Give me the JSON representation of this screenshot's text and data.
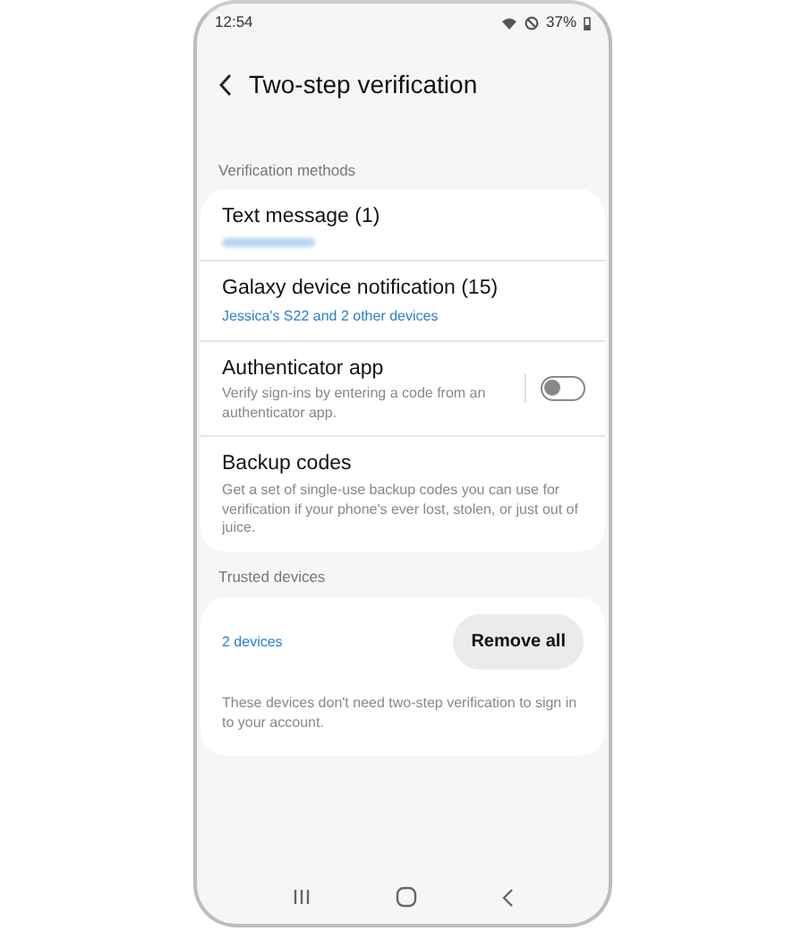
{
  "status_bar": {
    "time": "12:54",
    "battery": "37%"
  },
  "header": {
    "title": "Two-step verification"
  },
  "methods": {
    "heading": "Verification methods",
    "items": [
      {
        "kind": "masked",
        "title": "Text message (1)"
      },
      {
        "kind": "link",
        "title": "Galaxy device notification (15)",
        "subtitle": "Jessica's S22 and  2 other devices"
      },
      {
        "kind": "toggle",
        "title": "Authenticator app",
        "subtitle": "Verify sign-ins by entering a code from an authenticator app.",
        "on": false
      },
      {
        "kind": "text",
        "title": "Backup codes",
        "subtitle": "Get a set of single-use backup codes you can use for verification if your phone's ever lost, stolen, or just out of juice."
      }
    ]
  },
  "trusted": {
    "heading": "Trusted devices",
    "count": "2 devices",
    "button": "Remove all",
    "note": "These devices don't need two-step verification to sign in to your account."
  }
}
